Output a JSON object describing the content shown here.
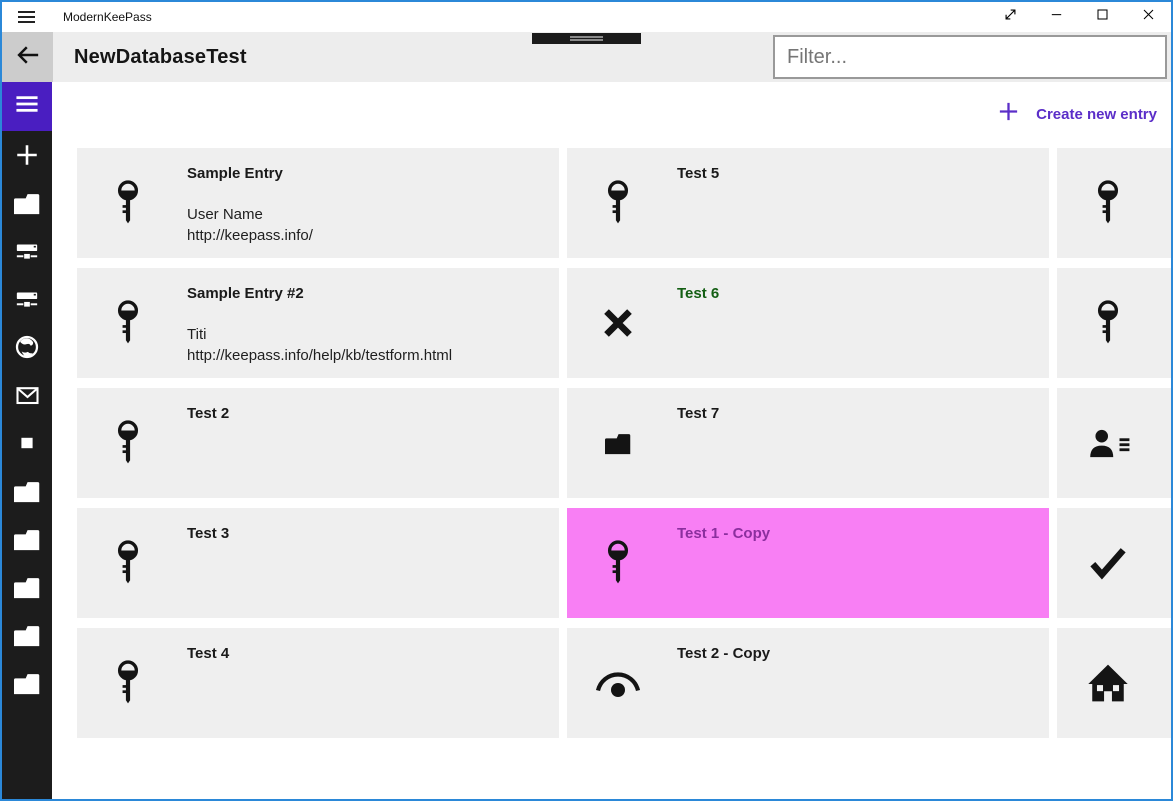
{
  "titlebar": {
    "app_title": "ModernKeePass",
    "controls": [
      {
        "icon": "fullscreen-icon"
      },
      {
        "icon": "minimize-icon"
      },
      {
        "icon": "maximize-icon"
      },
      {
        "icon": "close-icon"
      }
    ]
  },
  "header": {
    "db_title": "NewDatabaseTest",
    "back_icon": "back-arrow-icon",
    "filter_placeholder": "Filter..."
  },
  "sidebar": {
    "toggle_icon": "hamburger-icon",
    "items": [
      {
        "icon": "plus-icon"
      },
      {
        "icon": "folder-icon"
      },
      {
        "icon": "network-icon"
      },
      {
        "icon": "network-icon"
      },
      {
        "icon": "globe-icon"
      },
      {
        "icon": "mail-icon"
      },
      {
        "icon": "square-icon"
      },
      {
        "icon": "folder-icon"
      },
      {
        "icon": "folder-icon"
      },
      {
        "icon": "folder-icon"
      },
      {
        "icon": "folder-icon"
      },
      {
        "icon": "folder-icon"
      }
    ]
  },
  "toolbar": {
    "create_label": "Create new entry",
    "create_icon": "plus-icon"
  },
  "entries": [
    {
      "title": "Sample Entry",
      "icon": "key-icon",
      "lines": [
        "User Name",
        "http://keepass.info/"
      ]
    },
    {
      "title": "Sample Entry #2",
      "icon": "key-icon",
      "lines": [
        "Titi",
        "http://keepass.info/help/kb/testform.html"
      ]
    },
    {
      "title": "Test 2",
      "icon": "key-icon",
      "lines": []
    },
    {
      "title": "Test 3",
      "icon": "key-icon",
      "lines": []
    },
    {
      "title": "Test 4",
      "icon": "key-icon",
      "lines": []
    },
    {
      "title": "Test 5",
      "icon": "key-icon",
      "lines": []
    },
    {
      "title": "Test 6",
      "icon": "cancel-icon",
      "lines": [],
      "title_color": "#135e13"
    },
    {
      "title": "Test 7",
      "icon": "folder-icon",
      "lines": []
    },
    {
      "title": "Test 1 - Copy",
      "icon": "key-icon",
      "lines": [],
      "selected": true,
      "title_color": "#8b2f9e"
    },
    {
      "title": "Test 2 - Copy",
      "icon": "view-icon",
      "lines": []
    },
    {
      "title": "",
      "icon": "key-icon",
      "lines": []
    },
    {
      "title": "",
      "icon": "key-icon",
      "lines": []
    },
    {
      "title": "",
      "icon": "contact-icon",
      "lines": []
    },
    {
      "title": "",
      "icon": "check-icon",
      "lines": []
    },
    {
      "title": "",
      "icon": "home-icon",
      "lines": []
    }
  ],
  "colors": {
    "window_border": "#2b88d8",
    "accent_purple": "#4a1ec1",
    "link_purple": "#5b2ec8",
    "selected_bg": "#f87ff4",
    "selected_text": "#8b2f9e",
    "green_text": "#135e13",
    "card_bg": "#efefef",
    "sidebar_bg": "#1c1c1c"
  }
}
